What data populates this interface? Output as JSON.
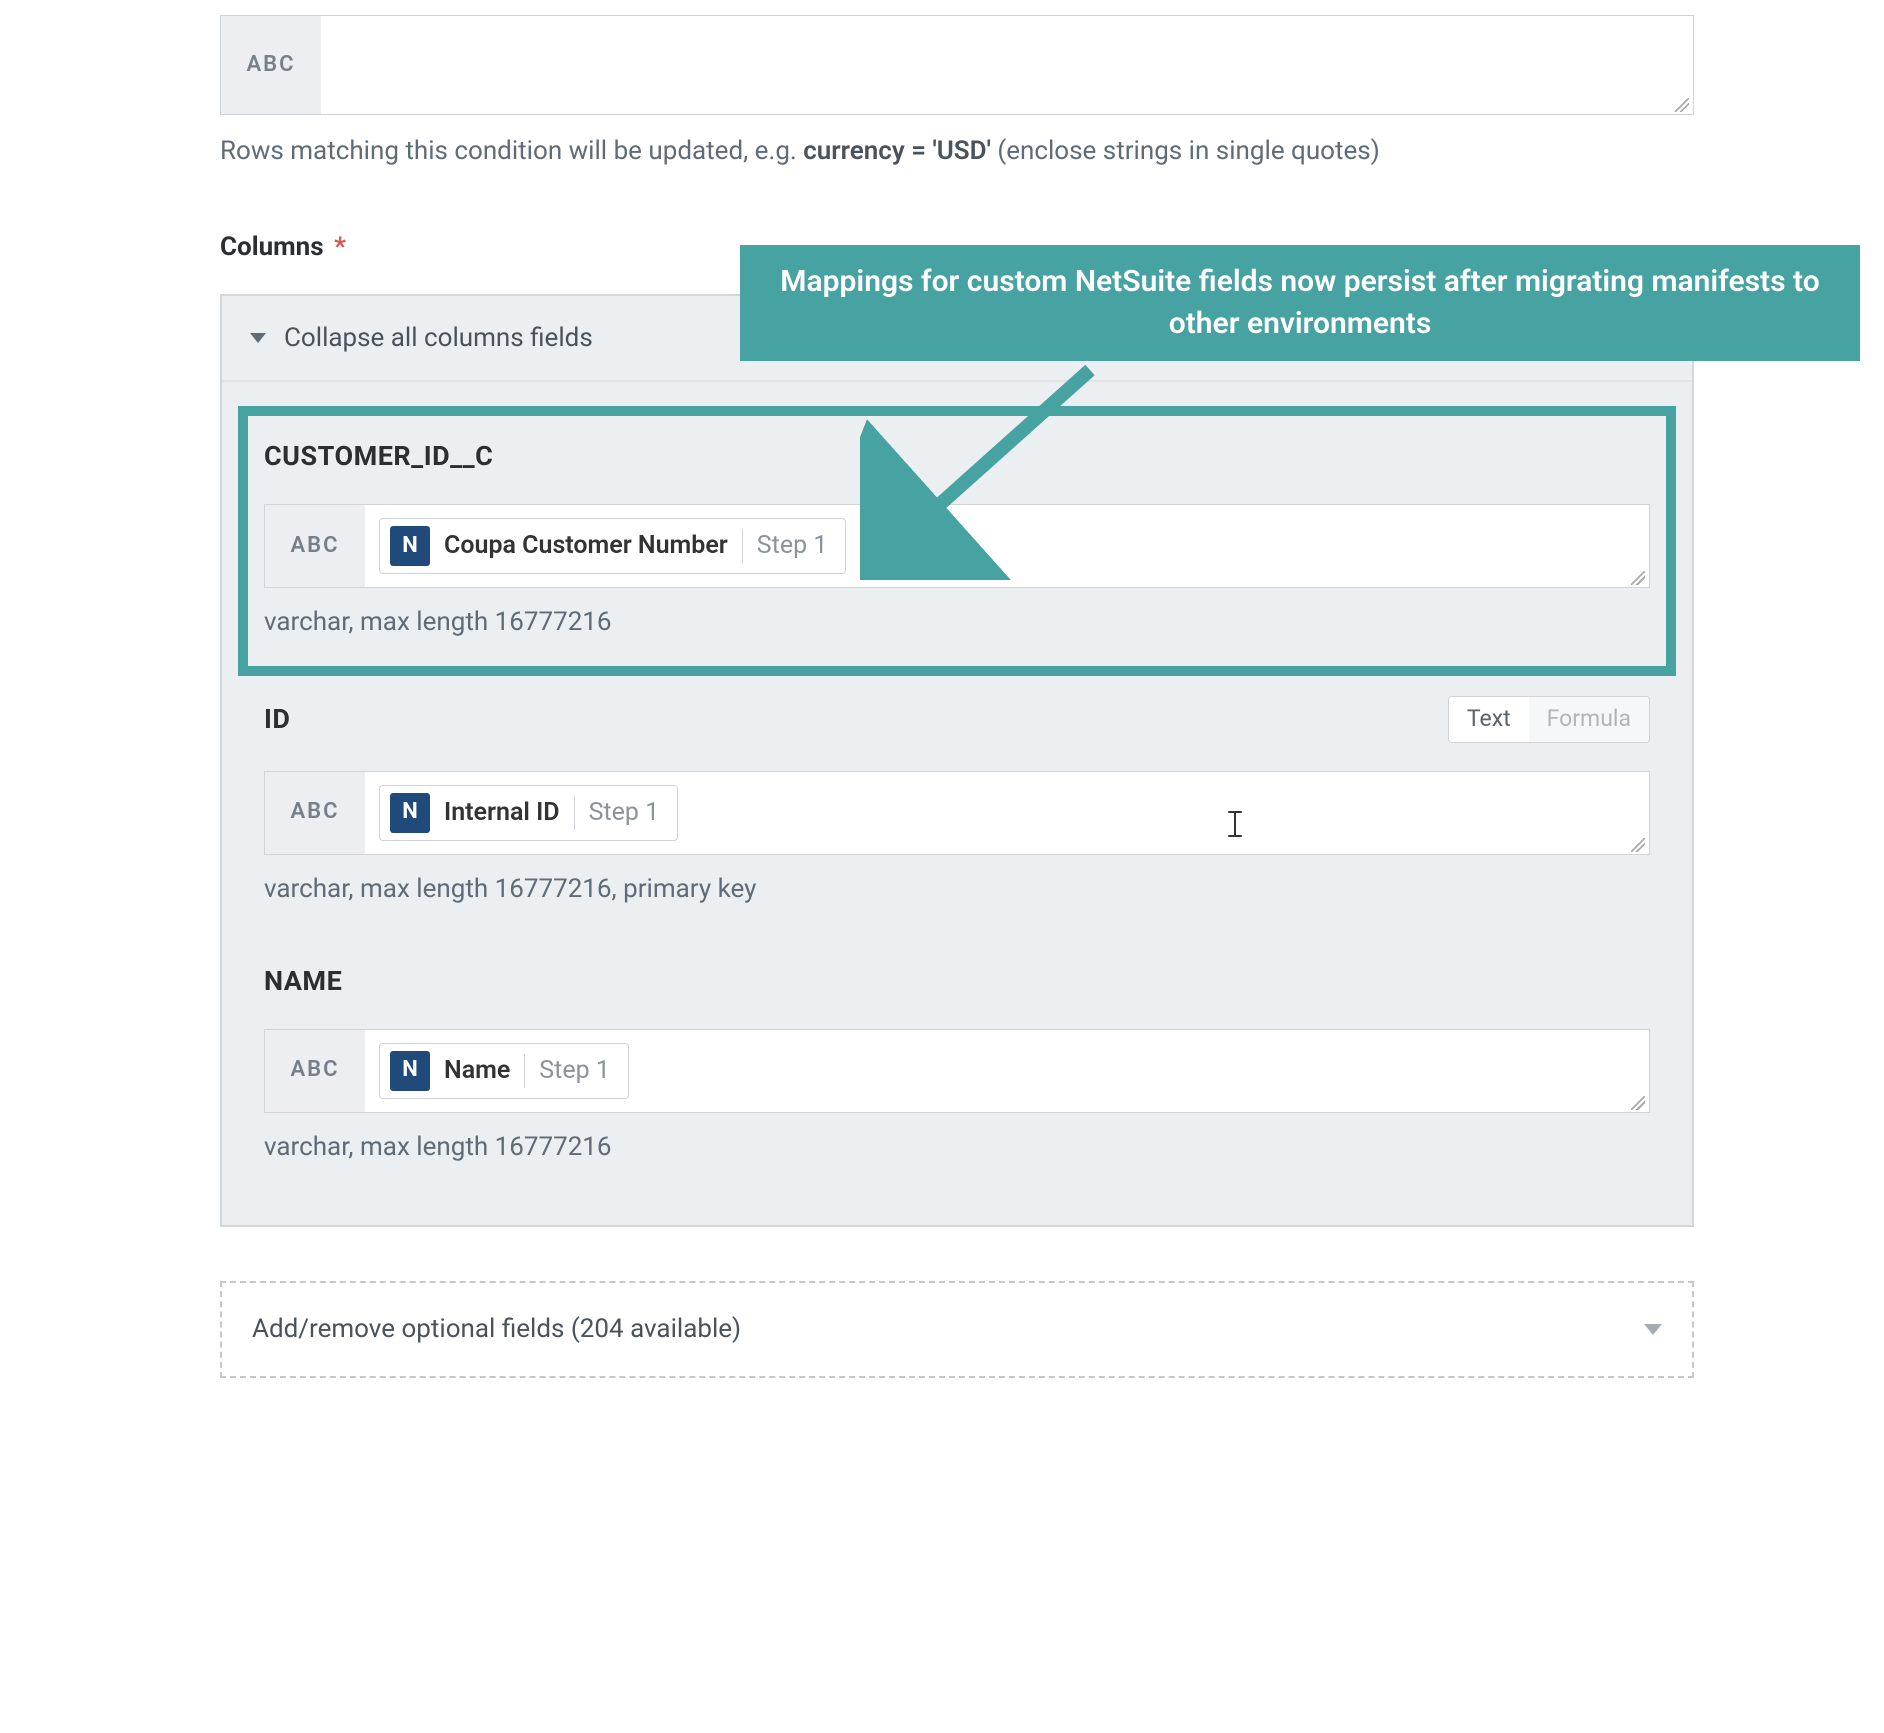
{
  "abc_label": "ABC",
  "filter_help_prefix": "Rows matching this condition will be updated, e.g. ",
  "filter_help_example": "currency = 'USD'",
  "filter_help_suffix": " (enclose strings in single quotes)",
  "callout_text": "Mappings for custom NetSuite fields now persist after migrating manifests to other environments",
  "columns_label": "Columns",
  "required_star": "*",
  "collapse_label": "Collapse all columns fields",
  "mode_text_label": "Text",
  "mode_formula_label": "Formula",
  "add_remove_label": "Add/remove optional fields (204 available)",
  "fields": {
    "customer_id_c": {
      "title": "CUSTOMER_ID__C",
      "pill_label": "Coupa Customer Number",
      "pill_step": "Step 1",
      "note": "varchar, max length 16777216"
    },
    "id": {
      "title": "ID",
      "pill_label": "Internal ID",
      "pill_step": "Step 1",
      "note": "varchar, max length 16777216, primary key"
    },
    "name": {
      "title": "NAME",
      "pill_label": "Name",
      "pill_step": "Step 1",
      "note": "varchar, max length 16777216"
    }
  }
}
